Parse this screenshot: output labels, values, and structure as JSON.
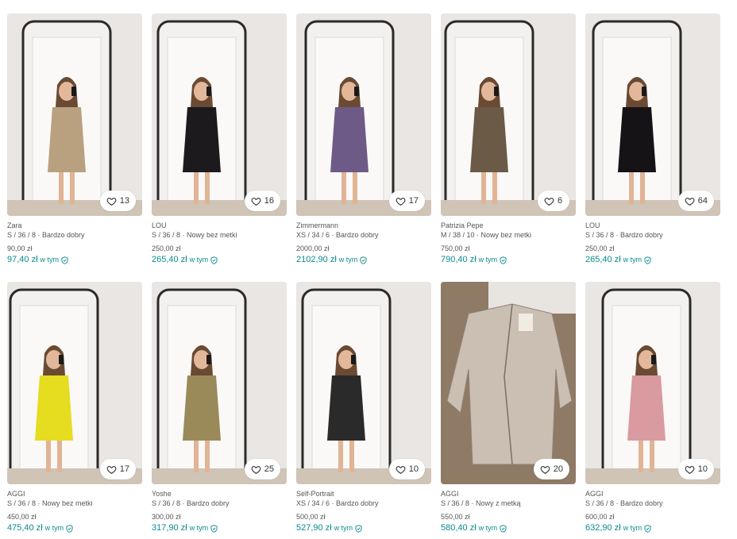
{
  "currency_suffix": "zł",
  "incl_label": "w tym",
  "accent_color": "#0b8a8f",
  "items": [
    {
      "brand": "Zara",
      "details": "S / 36 / 8 · Bardzo dobry",
      "price": "90,00 zł",
      "total": "97,40 zł",
      "favorites": "13",
      "image": "dress-mirror-selfie",
      "dress_color": "#b9a07f"
    },
    {
      "brand": "LOU",
      "details": "S / 36 / 8 · Nowy bez metki",
      "price": "250,00 zł",
      "total": "265,40 zł",
      "favorites": "16",
      "image": "dress-mirror-selfie",
      "dress_color": "#1c1a1c"
    },
    {
      "brand": "Zimmermann",
      "details": "XS / 34 / 6 · Bardzo dobry",
      "price": "2000,00 zł",
      "total": "2102,90 zł",
      "favorites": "17",
      "image": "dress-mirror-selfie",
      "dress_color": "#6e5a86"
    },
    {
      "brand": "Patrizia Pepe",
      "details": "M / 38 / 10 · Nowy bez metki",
      "price": "750,00 zł",
      "total": "790,40 zł",
      "favorites": "6",
      "image": "dress-mirror-selfie",
      "dress_color": "#6b5a45"
    },
    {
      "brand": "LOU",
      "details": "S / 36 / 8 · Bardzo dobry",
      "price": "250,00 zł",
      "total": "265,40 zł",
      "favorites": "64",
      "image": "dress-mirror-selfie",
      "dress_color": "#151316"
    },
    {
      "brand": "AGGI",
      "details": "S / 36 / 8 · Nowy bez metki",
      "price": "450,00 zł",
      "total": "475,40 zł",
      "favorites": "17",
      "image": "dress-mirror-selfie",
      "dress_color": "#e6dc20"
    },
    {
      "brand": "Yoshe",
      "details": "S / 36 / 8 · Bardzo dobry",
      "price": "300,00 zł",
      "total": "317,90 zł",
      "favorites": "25",
      "image": "dress-mirror-selfie",
      "dress_color": "#9a8a5a"
    },
    {
      "brand": "Self-Portrait",
      "details": "XS / 34 / 6 · Bardzo dobry",
      "price": "500,00 zł",
      "total": "527,90 zł",
      "favorites": "10",
      "image": "dress-mirror-selfie",
      "dress_color": "#2a2a2a"
    },
    {
      "brand": "AGGI",
      "details": "S / 36 / 8 · Nowy z metką",
      "price": "550,00 zł",
      "total": "580,40 zł",
      "favorites": "20",
      "image": "sequin-blazer-flatlay",
      "dress_color": "#cbbfb3"
    },
    {
      "brand": "AGGI",
      "details": "S / 36 / 8 · Bardzo dobry",
      "price": "600,00 zł",
      "total": "632,90 zł",
      "favorites": "10",
      "image": "dress-mirror-selfie",
      "dress_color": "#d99aa0"
    }
  ]
}
